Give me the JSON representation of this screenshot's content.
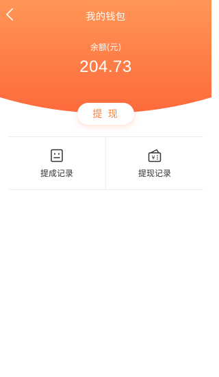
{
  "header": {
    "title": "我的钱包",
    "back_icon": "back-chevron-icon"
  },
  "balance": {
    "label": "余额(元)",
    "value": "204.73"
  },
  "actions": {
    "withdraw_label": "提 现"
  },
  "records": [
    {
      "label": "提成记录",
      "icon": "commission-record-icon"
    },
    {
      "label": "提现记录",
      "icon": "withdraw-record-icon"
    }
  ],
  "colors": {
    "header_gradient_top": "#ff8d52",
    "header_gradient_bottom": "#fd6c3d",
    "accent": "#f2843f"
  }
}
